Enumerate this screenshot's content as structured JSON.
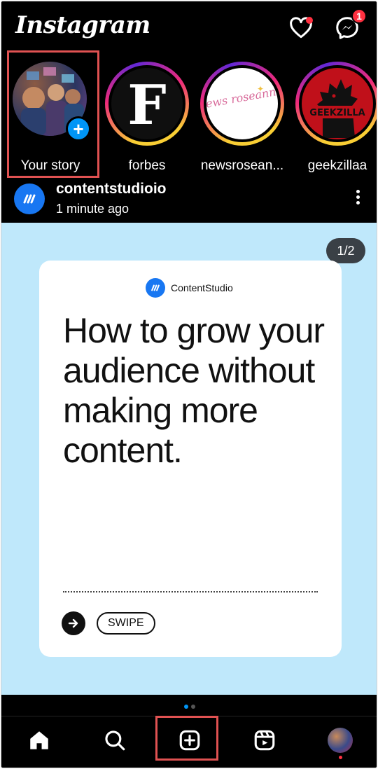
{
  "header": {
    "logo": "Instagram",
    "notifications_icon": "heart-icon",
    "messages_icon": "messenger-icon",
    "messages_badge": "1"
  },
  "stories": [
    {
      "label": "Your story",
      "icon": "plus-icon"
    },
    {
      "label": "forbes"
    },
    {
      "label": "newsrosean..."
    },
    {
      "label": "geekzillaa"
    }
  ],
  "story_art": {
    "forbes_letter": "F",
    "newsroseanne_logo": "news roseanne",
    "geekzilla_logo": "GEEKZILLA"
  },
  "post": {
    "username": "contentstudioio",
    "time": "1 minute ago",
    "counter": "1/2",
    "brand": "ContentStudio",
    "headline": "How to grow your audience without making more content.",
    "swipe_label": "SWIPE",
    "carousel_pages": 2,
    "carousel_active": 1
  },
  "nav": {
    "items": [
      "home-icon",
      "search-icon",
      "create-icon",
      "reels-icon",
      "profile-avatar"
    ]
  },
  "colors": {
    "accent": "#0095f6",
    "notification": "#ff3040",
    "media_bg": "#bfe8fb",
    "highlight_box": "#e05252"
  }
}
